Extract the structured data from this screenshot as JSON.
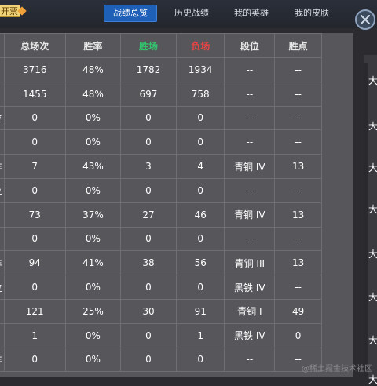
{
  "topbar": {
    "badge_text": "开票",
    "tabs": [
      {
        "label": "战绩总览",
        "active": true
      },
      {
        "label": "历史战绩",
        "active": false
      },
      {
        "label": "我的英雄",
        "active": false
      },
      {
        "label": "我的皮肤",
        "active": false
      }
    ]
  },
  "table": {
    "headers": [
      "",
      "总场次",
      "胜率",
      "胜场",
      "负场",
      "段位",
      "胜点"
    ],
    "header_colors": {
      "win": "#33c46c",
      "lose": "#e64545"
    },
    "rows": [
      [
        "",
        "3716",
        "48%",
        "1782",
        "1934",
        "--",
        "--"
      ],
      [
        "",
        "1455",
        "48%",
        "697",
        "758",
        "--",
        "--"
      ],
      [
        "位",
        "0",
        "0%",
        "0",
        "0",
        "--",
        "--"
      ],
      [
        "",
        "0",
        "0%",
        "0",
        "0",
        "--",
        "--"
      ],
      [
        "非",
        "7",
        "43%",
        "3",
        "4",
        "青铜 IV",
        "13"
      ],
      [
        "位",
        "0",
        "0%",
        "0",
        "0",
        "--",
        "--"
      ],
      [
        "",
        "73",
        "37%",
        "27",
        "46",
        "青铜 IV",
        "13"
      ],
      [
        "",
        "0",
        "0%",
        "0",
        "0",
        "--",
        "--"
      ],
      [
        "非",
        "94",
        "41%",
        "38",
        "56",
        "青铜 III",
        "13"
      ],
      [
        "位",
        "0",
        "0%",
        "0",
        "0",
        "黑铁 IV",
        "--"
      ],
      [
        "",
        "121",
        "25%",
        "30",
        "91",
        "青铜 I",
        "49"
      ],
      [
        "",
        "1",
        "0%",
        "0",
        "1",
        "黑铁 IV",
        "0"
      ],
      [
        "非",
        "0",
        "0%",
        "0",
        "0",
        "--",
        "--"
      ]
    ]
  },
  "side": {
    "items": [
      "大",
      "大",
      "大",
      "大",
      "大",
      "大",
      "大",
      "大"
    ]
  },
  "watermark": "@稀土掘金技术社区"
}
